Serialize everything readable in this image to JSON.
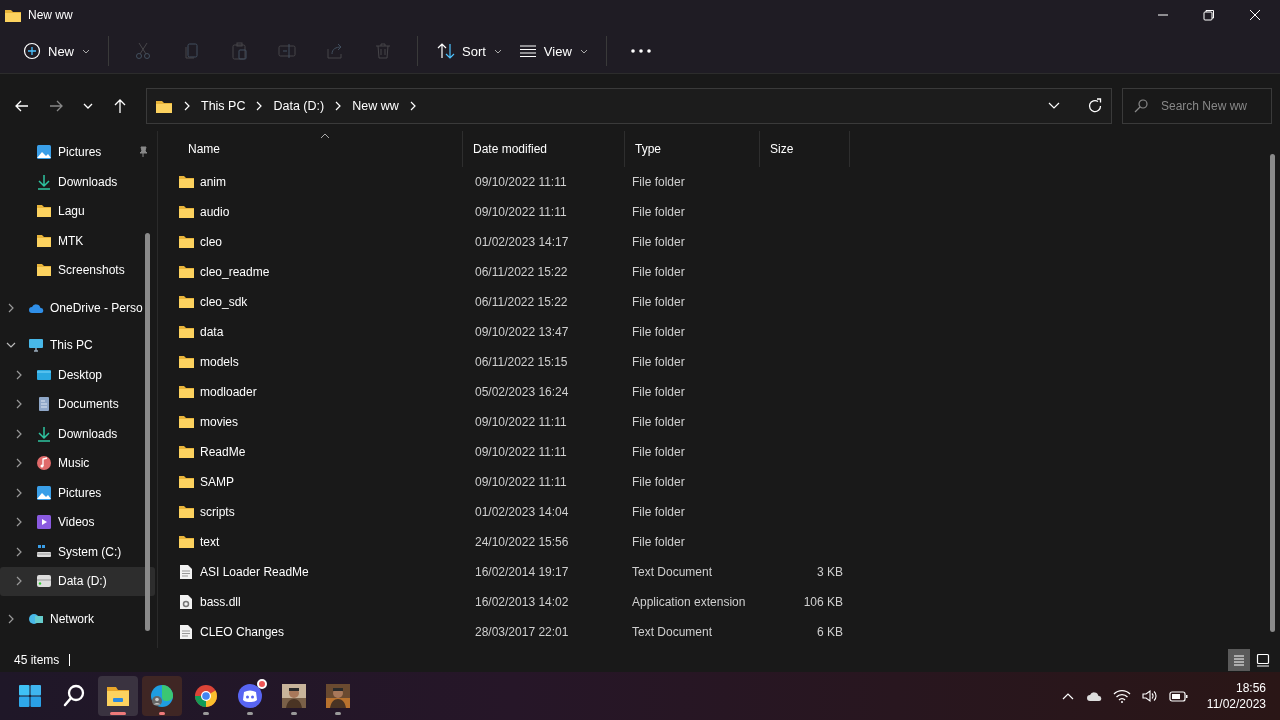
{
  "window": {
    "title": "New ww"
  },
  "toolbar": [
    {
      "kind": "new",
      "label": "New",
      "disabled": false
    },
    {
      "kind": "cut",
      "disabled": true
    },
    {
      "kind": "copy",
      "disabled": true
    },
    {
      "kind": "paste",
      "disabled": true
    },
    {
      "kind": "rename",
      "disabled": true
    },
    {
      "kind": "share",
      "disabled": true
    },
    {
      "kind": "delete",
      "disabled": true
    },
    {
      "kind": "sort",
      "label": "Sort",
      "disabled": false
    },
    {
      "kind": "view",
      "label": "View",
      "disabled": false
    },
    {
      "kind": "more",
      "disabled": false
    }
  ],
  "address": {
    "path": [
      "This PC",
      "Data (D:)",
      "New ww"
    ]
  },
  "search": {
    "placeholder": "Search New ww"
  },
  "sidebar": {
    "items": [
      {
        "label": "Pictures",
        "kind": "pictures",
        "pinned": true,
        "selected": false
      },
      {
        "label": "Downloads",
        "kind": "downloads",
        "pinned": false,
        "selected": false
      },
      {
        "label": "Lagu",
        "kind": "folder",
        "pinned": false,
        "selected": false
      },
      {
        "label": "MTK",
        "kind": "folder",
        "pinned": false,
        "selected": false
      },
      {
        "label": "Screenshots",
        "kind": "folder",
        "pinned": false,
        "selected": false
      },
      {
        "label": "OneDrive - Perso",
        "kind": "cloud",
        "expanded": false,
        "selected": false
      },
      {
        "label": "This PC",
        "kind": "pc",
        "expanded": true,
        "selected": false,
        "children": [
          {
            "label": "Desktop",
            "kind": "desktop",
            "expanded": false,
            "selected": false
          },
          {
            "label": "Documents",
            "kind": "documents",
            "expanded": false,
            "selected": false
          },
          {
            "label": "Downloads",
            "kind": "downloads",
            "expanded": false,
            "selected": false
          },
          {
            "label": "Music",
            "kind": "music",
            "expanded": false,
            "selected": false
          },
          {
            "label": "Pictures",
            "kind": "pictures",
            "expanded": false,
            "selected": false
          },
          {
            "label": "Videos",
            "kind": "videos",
            "expanded": false,
            "selected": false
          },
          {
            "label": "System (C:)",
            "kind": "system-drive",
            "expanded": false,
            "selected": false
          },
          {
            "label": "Data (D:)",
            "kind": "drive",
            "expanded": false,
            "selected": true
          }
        ]
      },
      {
        "label": "Network",
        "kind": "network",
        "expanded": false,
        "selected": false
      }
    ]
  },
  "files": {
    "columns": [
      {
        "label": "Name",
        "sorted": true
      },
      {
        "label": "Date modified",
        "sorted": false
      },
      {
        "label": "Type",
        "sorted": false
      },
      {
        "label": "Size",
        "sorted": false
      }
    ],
    "rows": [
      {
        "kind": "folder",
        "name": "anim",
        "date": "09/10/2022 11:11",
        "type": "File folder"
      },
      {
        "kind": "folder",
        "name": "audio",
        "date": "09/10/2022 11:11",
        "type": "File folder"
      },
      {
        "kind": "folder",
        "name": "cleo",
        "date": "01/02/2023 14:17",
        "type": "File folder"
      },
      {
        "kind": "folder",
        "name": "cleo_readme",
        "date": "06/11/2022 15:22",
        "type": "File folder"
      },
      {
        "kind": "folder",
        "name": "cleo_sdk",
        "date": "06/11/2022 15:22",
        "type": "File folder"
      },
      {
        "kind": "folder",
        "name": "data",
        "date": "09/10/2022 13:47",
        "type": "File folder"
      },
      {
        "kind": "folder",
        "name": "models",
        "date": "06/11/2022 15:15",
        "type": "File folder"
      },
      {
        "kind": "folder",
        "name": "modloader",
        "date": "05/02/2023 16:24",
        "type": "File folder"
      },
      {
        "kind": "folder",
        "name": "movies",
        "date": "09/10/2022 11:11",
        "type": "File folder"
      },
      {
        "kind": "folder",
        "name": "ReadMe",
        "date": "09/10/2022 11:11",
        "type": "File folder"
      },
      {
        "kind": "folder",
        "name": "SAMP",
        "date": "09/10/2022 11:11",
        "type": "File folder"
      },
      {
        "kind": "folder",
        "name": "scripts",
        "date": "01/02/2023 14:04",
        "type": "File folder"
      },
      {
        "kind": "folder",
        "name": "text",
        "date": "24/10/2022 15:56",
        "type": "File folder"
      },
      {
        "kind": "text",
        "name": "ASI Loader ReadMe",
        "date": "16/02/2014 19:17",
        "type": "Text Document",
        "size": "3 KB"
      },
      {
        "kind": "dll",
        "name": "bass.dll",
        "date": "16/02/2013 14:02",
        "type": "Application extension",
        "size": "106 KB"
      },
      {
        "kind": "text",
        "name": "CLEO Changes",
        "date": "28/03/2017 22:01",
        "type": "Text Document",
        "size": "6 KB"
      }
    ]
  },
  "status_bar": {
    "count": "45 items",
    "views": [
      {
        "kind": "details",
        "selected": true
      },
      {
        "kind": "tiles",
        "selected": false
      }
    ]
  },
  "taskbar": {
    "apps": [
      {
        "kind": "start",
        "running": false,
        "focused": false,
        "attention": false
      },
      {
        "kind": "search",
        "running": false,
        "focused": false,
        "attention": false
      },
      {
        "kind": "explorer",
        "running": true,
        "focused": true,
        "attention": false
      },
      {
        "kind": "edge",
        "running": true,
        "focused": false,
        "attention": true
      },
      {
        "kind": "chrome",
        "running": true,
        "focused": false,
        "attention": false
      },
      {
        "kind": "discord",
        "running": true,
        "focused": false,
        "attention": false,
        "badge": true
      },
      {
        "kind": "picture",
        "running": true,
        "focused": false,
        "attention": false
      },
      {
        "kind": "picture",
        "running": true,
        "focused": false,
        "attention": false
      }
    ],
    "clock": {
      "time": "18:56",
      "date": "11/02/2023"
    }
  }
}
